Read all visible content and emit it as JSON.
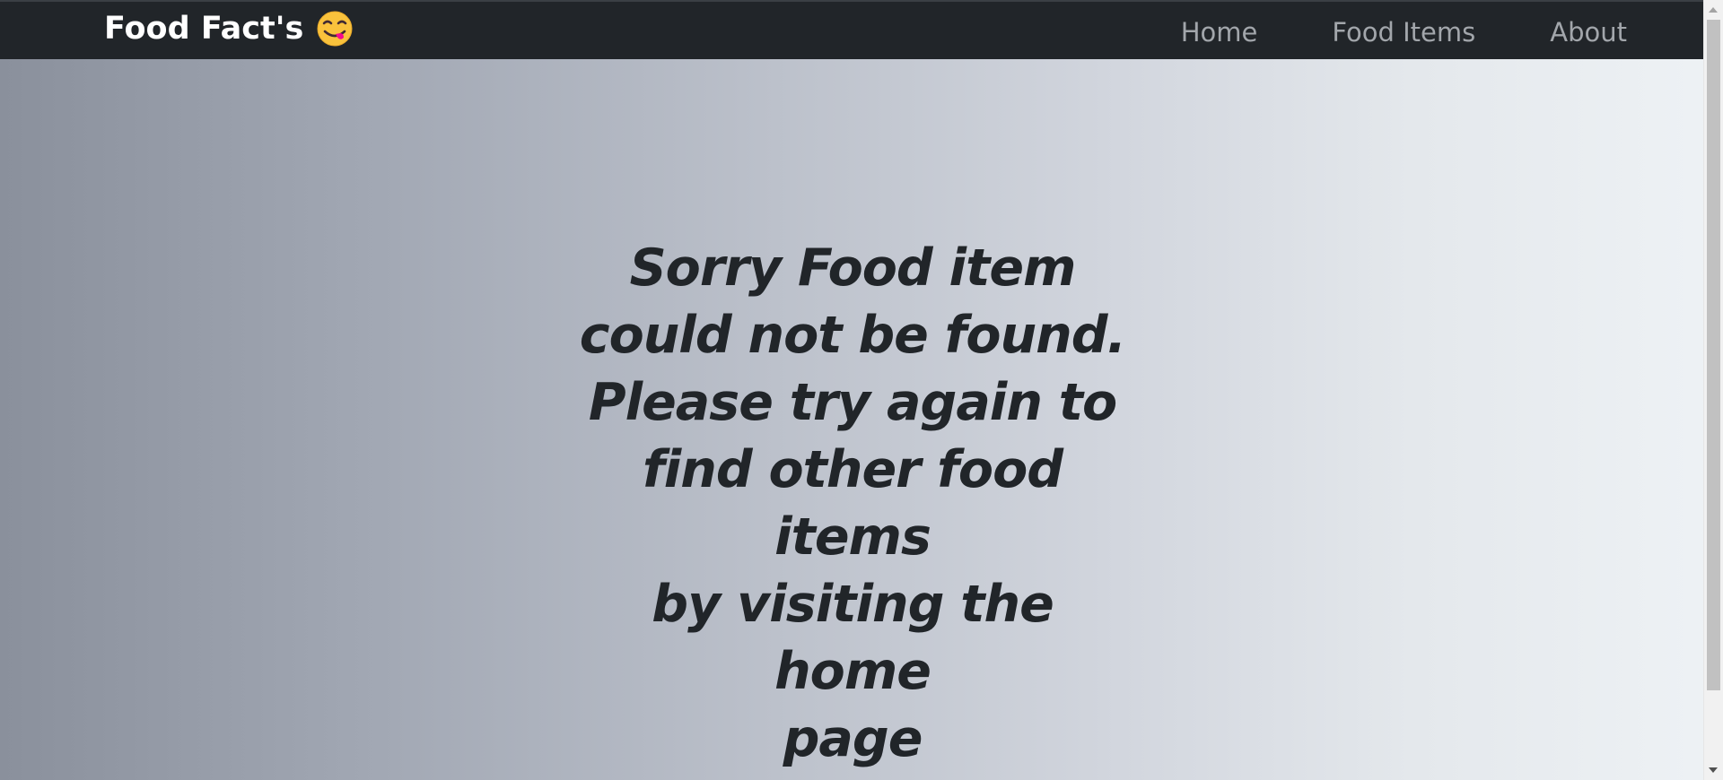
{
  "navbar": {
    "brand": "Food Fact's",
    "brand_emoji_icon": "face-savoring-food-icon",
    "links": [
      "Home",
      "Food Items",
      "About"
    ]
  },
  "main": {
    "message": "Sorry Food item\ncould not be found.\nPlease try again to\nfind other food items\nby visiting the home\npage"
  },
  "colors": {
    "navbar_bg": "#212529",
    "brand_text": "#ffffff",
    "nav_link": "#a2a6ab",
    "message_text": "#212529",
    "gradient_start": "#8a909c",
    "gradient_end": "#eef2f5"
  }
}
